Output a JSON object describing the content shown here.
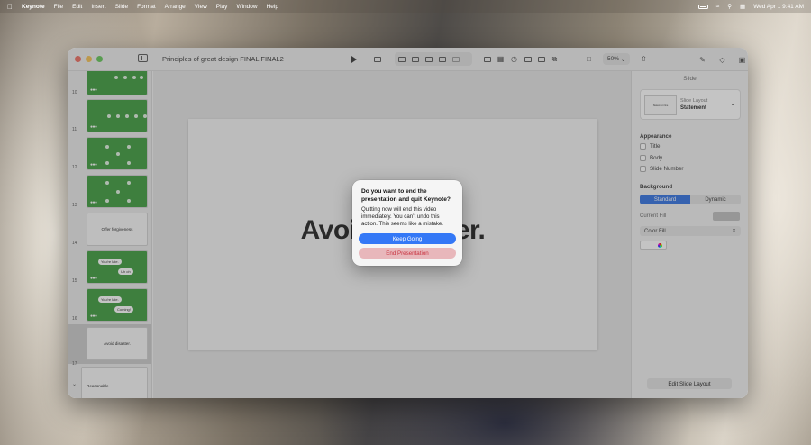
{
  "menubar": {
    "app_name": "Keynote",
    "items": [
      "File",
      "Edit",
      "Insert",
      "Slide",
      "Format",
      "Arrange",
      "View",
      "Play",
      "Window",
      "Help"
    ],
    "datetime": "Wed Apr 1  9:41 AM"
  },
  "window": {
    "document_title": "Principles of great design FINAL FINAL2",
    "zoom": "50%"
  },
  "navigator": {
    "slides": [
      {
        "number": "10",
        "style": "green"
      },
      {
        "number": "11",
        "style": "green"
      },
      {
        "number": "12",
        "style": "green"
      },
      {
        "number": "13",
        "style": "green"
      },
      {
        "number": "14",
        "style": "white",
        "caption": "Offer forgiveness"
      },
      {
        "number": "15",
        "style": "green",
        "bubble1": "You're late.",
        "bubble2": "Uh oh"
      },
      {
        "number": "16",
        "style": "green",
        "bubble1": "You're late.",
        "bubble2": "Coming!"
      },
      {
        "number": "17",
        "style": "white",
        "caption": "Avoid disaster."
      }
    ],
    "next_thumb_caption": "Reasonable"
  },
  "slide": {
    "text": "Avoid disaster."
  },
  "inspector": {
    "header": "Slide",
    "layout_label": "Slide Layout",
    "layout_name": "Statement",
    "layout_mini_caption": "Statement line",
    "appearance_label": "Appearance",
    "appearance_options": [
      "Title",
      "Body",
      "Slide Number"
    ],
    "background_label": "Background",
    "background_segments": [
      "Standard",
      "Dynamic"
    ],
    "current_fill_label": "Current Fill",
    "fill_type": "Color Fill",
    "edit_layout_button": "Edit Slide Layout"
  },
  "dialog": {
    "title": "Do you want to end the presentation and quit Keynote?",
    "message": "Quitting now will end this video immediately. You can’t undo this action. This seems like a mistake.",
    "primary_button": "Keep Going",
    "destructive_button": "End Presentation"
  },
  "colors": {
    "accent": "#3478f6",
    "slide_green": "#3a9a3a",
    "destructive_text": "#c8323f"
  }
}
